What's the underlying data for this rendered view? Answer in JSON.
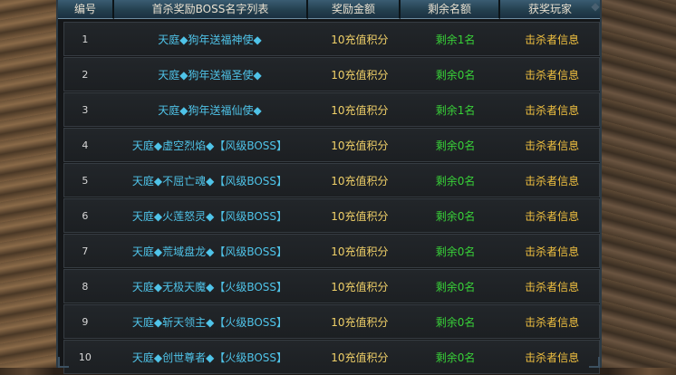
{
  "header": {
    "col_no": "编号",
    "col_list": "首杀奖励BOSS名字列表",
    "col_reward": "奖励金额",
    "col_remaining": "剩余名额",
    "col_player": "获奖玩家"
  },
  "rows": [
    {
      "no": "1",
      "name": "天庭◆狗年送福神使◆",
      "reward": "10充值积分",
      "remaining": "剩余1名",
      "player": "击杀者信息"
    },
    {
      "no": "2",
      "name": "天庭◆狗年送福圣使◆",
      "reward": "10充值积分",
      "remaining": "剩余0名",
      "player": "击杀者信息"
    },
    {
      "no": "3",
      "name": "天庭◆狗年送福仙使◆",
      "reward": "10充值积分",
      "remaining": "剩余1名",
      "player": "击杀者信息"
    },
    {
      "no": "4",
      "name": "天庭◆虚空烈焰◆【风级BOSS】",
      "reward": "10充值积分",
      "remaining": "剩余0名",
      "player": "击杀者信息"
    },
    {
      "no": "5",
      "name": "天庭◆不屈亡魂◆【风级BOSS】",
      "reward": "10充值积分",
      "remaining": "剩余0名",
      "player": "击杀者信息"
    },
    {
      "no": "6",
      "name": "天庭◆火莲怒灵◆【风级BOSS】",
      "reward": "10充值积分",
      "remaining": "剩余0名",
      "player": "击杀者信息"
    },
    {
      "no": "7",
      "name": "天庭◆荒域盘龙◆【风级BOSS】",
      "reward": "10充值积分",
      "remaining": "剩余0名",
      "player": "击杀者信息"
    },
    {
      "no": "8",
      "name": "天庭◆无极天魔◆【火级BOSS】",
      "reward": "10充值积分",
      "remaining": "剩余0名",
      "player": "击杀者信息"
    },
    {
      "no": "9",
      "name": "天庭◆斩天领主◆【火级BOSS】",
      "reward": "10充值积分",
      "remaining": "剩余0名",
      "player": "击杀者信息"
    },
    {
      "no": "10",
      "name": "天庭◆创世尊者◆【火级BOSS】",
      "reward": "10充值积分",
      "remaining": "剩余0名",
      "player": "击杀者信息"
    }
  ],
  "colors": {
    "name": "#4fc3e8",
    "reward": "#f0d068",
    "remaining": "#38d038",
    "player": "#f0c040"
  }
}
